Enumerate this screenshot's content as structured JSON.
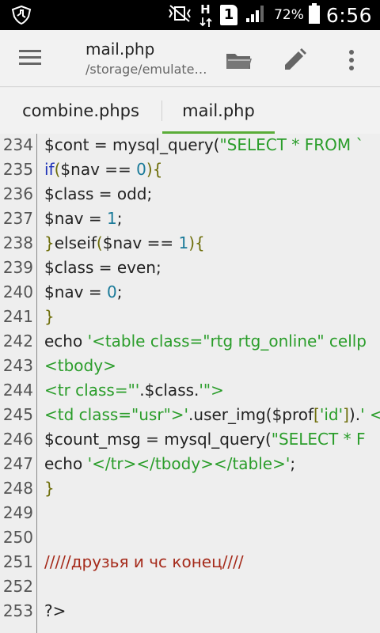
{
  "status_bar": {
    "battery_percent": "72%",
    "time": "6:56",
    "sim_label": "1",
    "network_label": "H"
  },
  "toolbar": {
    "title": "mail.php",
    "path": "/storage/emulate…"
  },
  "tabs": [
    {
      "label": "combine.phps",
      "active": false
    },
    {
      "label": "mail.php",
      "active": true
    }
  ],
  "editor": {
    "lines": [
      {
        "num": "234",
        "tokens": [
          [
            "plain",
            "$cont = mysql_query("
          ],
          [
            "str",
            "\"SELECT * FROM `"
          ]
        ]
      },
      {
        "num": "235",
        "tokens": [
          [
            "kw",
            "if"
          ],
          [
            "brace",
            "("
          ],
          [
            "plain",
            "$nav == "
          ],
          [
            "num",
            "0"
          ],
          [
            "brace",
            "){"
          ]
        ]
      },
      {
        "num": "236",
        "tokens": [
          [
            "plain",
            "$class = odd;"
          ]
        ]
      },
      {
        "num": "237",
        "tokens": [
          [
            "plain",
            "$nav = "
          ],
          [
            "num",
            "1"
          ],
          [
            "plain",
            ";"
          ]
        ]
      },
      {
        "num": "238",
        "tokens": [
          [
            "brace",
            "}"
          ],
          [
            "plain",
            "elseif"
          ],
          [
            "brace",
            "("
          ],
          [
            "plain",
            "$nav == "
          ],
          [
            "num",
            "1"
          ],
          [
            "brace",
            "){"
          ]
        ]
      },
      {
        "num": "239",
        "tokens": [
          [
            "plain",
            "$class = even;"
          ]
        ]
      },
      {
        "num": "240",
        "tokens": [
          [
            "plain",
            "$nav = "
          ],
          [
            "num",
            "0"
          ],
          [
            "plain",
            ";"
          ]
        ]
      },
      {
        "num": "241",
        "tokens": [
          [
            "brace",
            "}"
          ]
        ]
      },
      {
        "num": "242",
        "tokens": [
          [
            "plain",
            "echo "
          ],
          [
            "str",
            "'<table class=\"rtg rtg_online\" cellp"
          ]
        ]
      },
      {
        "num": "243",
        "tokens": [
          [
            "str",
            "<tbody>"
          ]
        ]
      },
      {
        "num": "244",
        "tokens": [
          [
            "str",
            "<tr class=\"'"
          ],
          [
            "plain",
            ".$class."
          ],
          [
            "str",
            "'\">"
          ]
        ]
      },
      {
        "num": "245",
        "tokens": [
          [
            "str",
            "<td class=\"usr\">'"
          ],
          [
            "plain",
            ".user_img("
          ],
          [
            "plain",
            "$prof"
          ],
          [
            "brace",
            "["
          ],
          [
            "str",
            "'id'"
          ],
          [
            "brace",
            "]"
          ],
          [
            "plain",
            ")."
          ],
          [
            "str",
            "' <"
          ]
        ]
      },
      {
        "num": "246",
        "tokens": [
          [
            "plain",
            "$count_msg = mysql_query("
          ],
          [
            "str",
            "\"SELECT * F"
          ]
        ]
      },
      {
        "num": "247",
        "tokens": [
          [
            "plain",
            "echo "
          ],
          [
            "str",
            "'</tr></tbody></table>'"
          ],
          [
            "plain",
            ";"
          ]
        ]
      },
      {
        "num": "248",
        "tokens": [
          [
            "brace",
            "}"
          ]
        ]
      },
      {
        "num": "249",
        "tokens": []
      },
      {
        "num": "250",
        "tokens": []
      },
      {
        "num": "251",
        "tokens": [
          [
            "comment",
            "/////друзья и чс конец////"
          ]
        ]
      },
      {
        "num": "252",
        "tokens": []
      },
      {
        "num": "253",
        "tokens": [
          [
            "plain",
            "?>"
          ]
        ]
      }
    ]
  },
  "icons": {
    "menu": "hamburger-menu-icon",
    "folder": "folder-open-icon",
    "edit": "pencil-icon",
    "more": "overflow-menu-icon"
  }
}
